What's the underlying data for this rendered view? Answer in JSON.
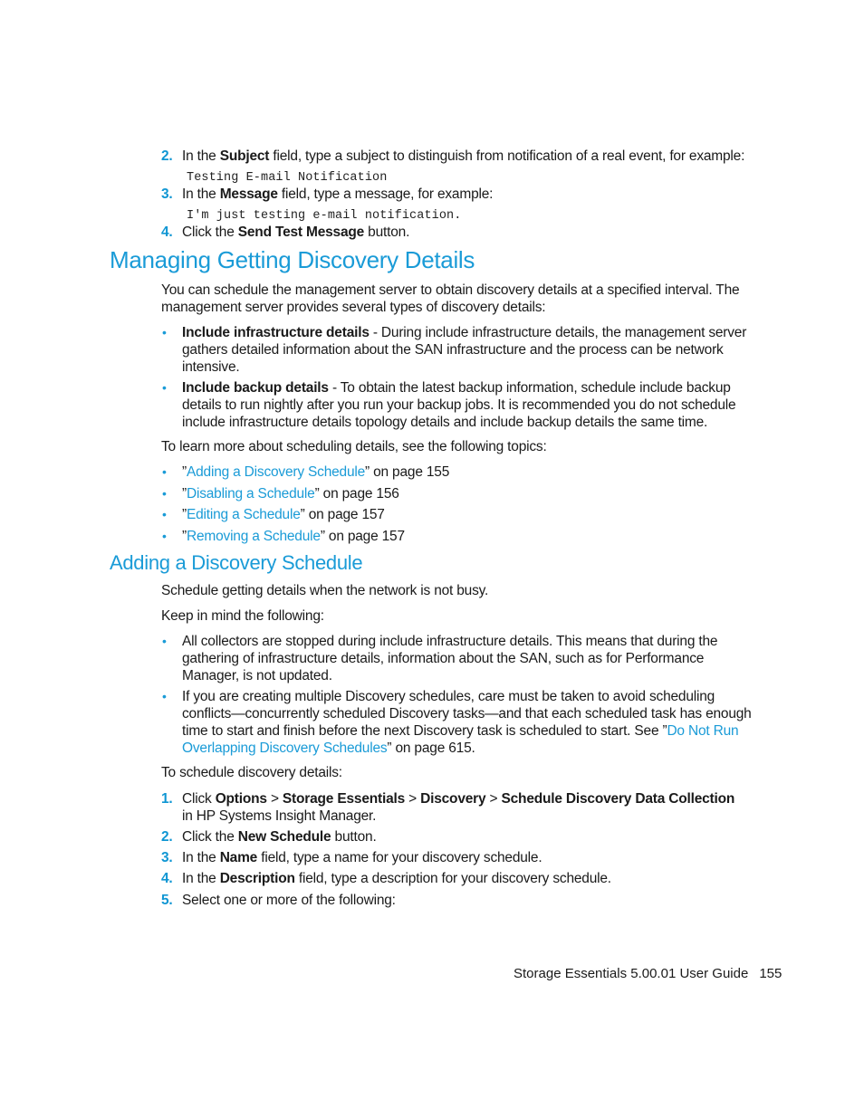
{
  "top_steps": [
    {
      "num": "2.",
      "pre": "In the ",
      "bold": "Subject",
      "post": " field, type a subject to distinguish from notification of a real event, for example:",
      "example": "Testing E-mail Notification"
    },
    {
      "num": "3.",
      "pre": "In the ",
      "bold": "Message",
      "post": " field, type a message, for example:",
      "example": "I'm just testing e-mail notification."
    },
    {
      "num": "4.",
      "pre": "Click the ",
      "bold": "Send Test Message",
      "post": " button."
    }
  ],
  "section1": {
    "title": "Managing Getting Discovery Details",
    "intro": "You can schedule the management server to obtain discovery details at a specified interval. The management server provides several types of discovery details:",
    "bullets": [
      {
        "bold": "Include infrastructure details",
        "text": " - During include infrastructure details, the management server gathers detailed information about the SAN infrastructure and the process can be network intensive."
      },
      {
        "bold": "Include backup details",
        "text": " - To obtain the latest backup information, schedule include backup details to run nightly after you run your backup jobs. It is recommended you do not schedule include infrastructure details topology details and include backup details the same time."
      }
    ],
    "topics_intro": "To learn more about scheduling details, see the following topics:",
    "topics": [
      {
        "open": "”",
        "link": "Adding a Discovery Schedule",
        "close": "” on page 155"
      },
      {
        "open": "”",
        "link": "Disabling a Schedule",
        "close": "” on page 156"
      },
      {
        "open": "”",
        "link": "Editing a Schedule",
        "close": "” on page 157"
      },
      {
        "open": "”",
        "link": "Removing a Schedule",
        "close": "” on page 157"
      }
    ]
  },
  "section2": {
    "title": "Adding a Discovery Schedule",
    "p1": "Schedule getting details when the network is not busy.",
    "p2": "Keep in mind the following:",
    "bullets": [
      {
        "text": "All collectors are stopped during include infrastructure details. This means that during the gathering of infrastructure details, information about the SAN, such as for Performance Manager, is not updated."
      },
      {
        "text": "If you are creating multiple Discovery schedules, care must be taken to avoid scheduling conflicts—concurrently scheduled Discovery tasks—and that each scheduled task has enough time to start and finish before the next Discovery task is scheduled to start. See ”",
        "link": "Do Not Run Overlapping Discovery Schedules",
        "after": "” on page 615."
      }
    ],
    "steps_intro": "To schedule discovery details:",
    "steps": [
      {
        "num": "1.",
        "pre": "Click ",
        "path": [
          "Options",
          "Storage Essentials",
          "Discovery",
          "Schedule Discovery Data Collection"
        ],
        "sep": " > ",
        "post": " in HP Systems Insight Manager."
      },
      {
        "num": "2.",
        "pre": "Click the ",
        "bold": "New Schedule",
        "post": " button."
      },
      {
        "num": "3.",
        "pre": "In the ",
        "bold": "Name",
        "post": " field, type a name for your discovery schedule."
      },
      {
        "num": "4.",
        "pre": "In the ",
        "bold": "Description",
        "post": " field, type a description for your discovery schedule."
      },
      {
        "num": "5.",
        "pre": "Select one or more of the following:"
      }
    ]
  },
  "footer": {
    "guide": "Storage Essentials 5.00.01 User Guide",
    "page": "155"
  },
  "colors": {
    "accent": "#1a9bd7",
    "text": "#1a1a1a"
  }
}
